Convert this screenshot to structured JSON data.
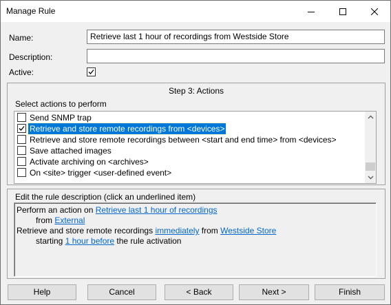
{
  "window": {
    "title": "Manage Rule"
  },
  "form": {
    "name_label": "Name:",
    "name_value": "Retrieve last 1 hour of recordings from Westside Store",
    "description_label": "Description:",
    "description_value": "",
    "active_label": "Active:",
    "active_checked": true
  },
  "step": {
    "title": "Step 3: Actions",
    "select_label": "Select actions to perform",
    "items": [
      {
        "label": "Send SNMP trap",
        "checked": false,
        "selected": false
      },
      {
        "label": "Retrieve and store remote recordings from <devices>",
        "checked": true,
        "selected": true
      },
      {
        "label": "Retrieve and store remote recordings between <start and end time> from <devices>",
        "checked": false,
        "selected": false
      },
      {
        "label": "Save attached images",
        "checked": false,
        "selected": false
      },
      {
        "label": "Activate archiving on <archives>",
        "checked": false,
        "selected": false
      },
      {
        "label": "On <site> trigger <user-defined event>",
        "checked": false,
        "selected": false
      }
    ]
  },
  "description_panel": {
    "title": "Edit the rule description (click an underlined item)",
    "line1_text": "Perform an action on ",
    "line1_link": "Retrieve last 1 hour of recordings",
    "line2_text": "from ",
    "line2_link": "External",
    "line3_text_a": "Retrieve and store remote recordings ",
    "line3_link_a": "immediately",
    "line3_text_b": " from ",
    "line3_link_b": "Westside Store",
    "line4_text_a": "starting ",
    "line4_link": "1 hour before",
    "line4_text_b": " the rule activation"
  },
  "buttons": {
    "help": "Help",
    "cancel": "Cancel",
    "back": "< Back",
    "next": "Next >",
    "finish": "Finish"
  }
}
